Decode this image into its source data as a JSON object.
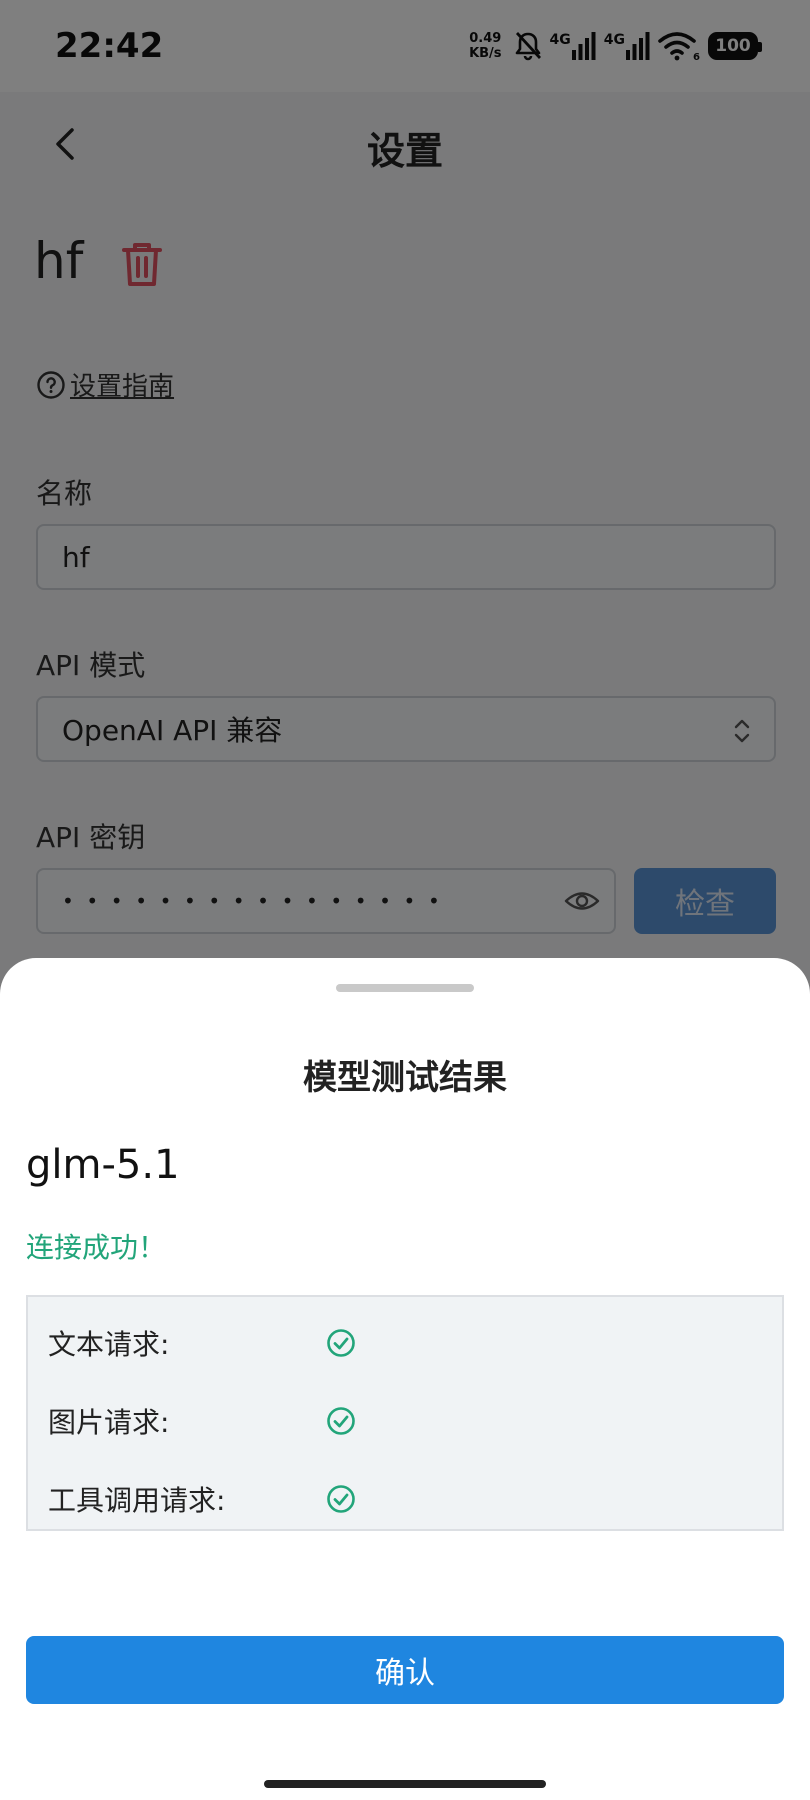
{
  "status_bar": {
    "time": "22:42",
    "net_speed_value": "0.49",
    "net_speed_unit": "KB/s",
    "signal1_label": "4G",
    "signal2_label": "4G",
    "wifi_badge": "6",
    "battery": "100"
  },
  "page": {
    "title": "设置",
    "provider_name": "hf",
    "guide_link": "设置指南",
    "name_label": "名称",
    "name_value": "hf",
    "api_mode_label": "API 模式",
    "api_mode_value": "OpenAI API 兼容",
    "api_key_label": "API 密钥",
    "api_key_mask": "••••••••••••••••",
    "check_button": "检查"
  },
  "sheet": {
    "title": "模型测试结果",
    "model": "glm-5.1",
    "status": "连接成功！",
    "results": [
      {
        "label": "文本请求:",
        "ok": true
      },
      {
        "label": "图片请求:",
        "ok": true
      },
      {
        "label": "工具调用请求:",
        "ok": true
      }
    ],
    "confirm_button": "确认"
  },
  "colors": {
    "success": "#22a57a",
    "primary": "#1f86e0",
    "danger": "#e05060"
  }
}
